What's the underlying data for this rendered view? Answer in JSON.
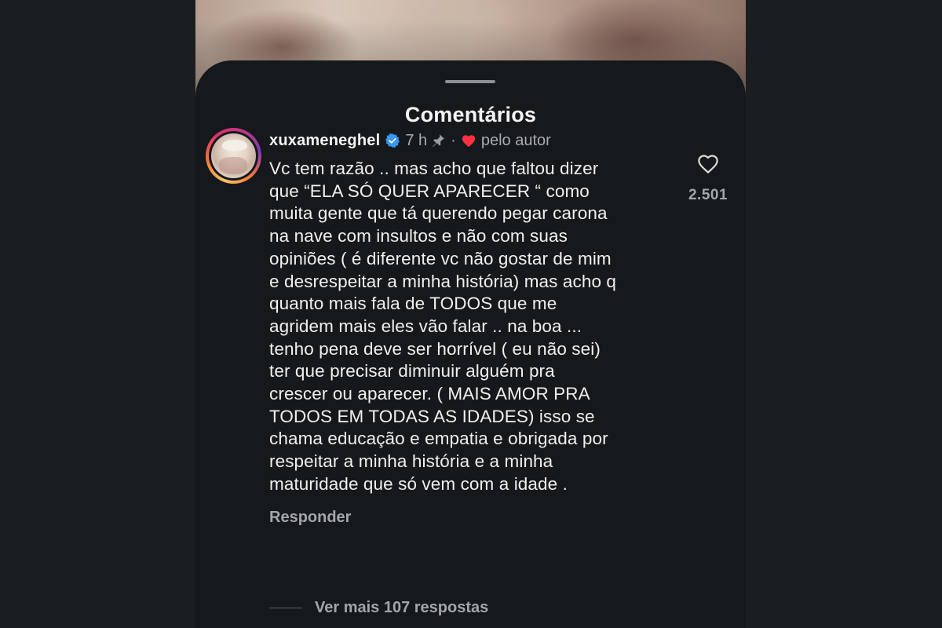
{
  "sheet": {
    "title": "Comentários"
  },
  "comment": {
    "username": "xuxameneghel",
    "time": "7 h",
    "separator": "·",
    "liked_by_author": "pelo autor",
    "text": "Vc tem razão .. mas acho que faltou dizer\nque “ELA SÓ QUER APARECER “ como\nmuita gente que tá querendo pegar carona\nna nave com insultos e não com suas\nopiniões ( é diferente vc não gostar de mim\ne desrespeitar a minha história) mas acho q\nquanto mais fala de TODOS que me\nagridem mais eles vão falar .. na boa ...\ntenho pena deve ser horrível ( eu não sei)\nter que precisar diminuir alguém pra\ncrescer ou aparecer. ( MAIS AMOR PRA\nTODOS EM TODAS AS IDADES) isso se\nchama educação e empatia  e obrigada por\nrespeitar a minha história e a minha\nmaturidade que só vem com a idade .",
    "reply_label": "Responder",
    "like_count": "2.501",
    "more_replies_label": "Ver mais 107 respostas"
  },
  "icons": {
    "verified": "verified-badge-icon",
    "pin": "pin-icon",
    "author_like": "heart-filled-icon",
    "like": "heart-outline-icon"
  },
  "colors": {
    "background": "#1b1e21",
    "sheet": "#16191c",
    "verified_blue": "#3897f0",
    "heart_red": "#ff3040",
    "muted_text": "#a3a6aa"
  }
}
